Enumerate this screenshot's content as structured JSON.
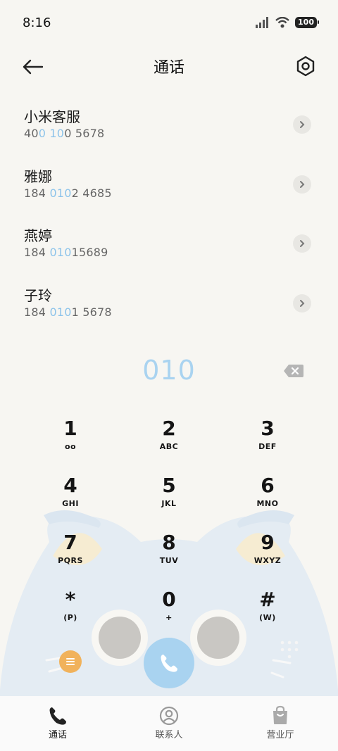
{
  "status": {
    "time": "8:16",
    "battery": "100"
  },
  "header": {
    "title": "通话",
    "back_icon": "arrow-left-icon",
    "settings_icon": "hexagon-settings-icon"
  },
  "results": [
    {
      "name": "小米客服",
      "number_parts": [
        "40",
        "0 10",
        "0 5678"
      ]
    },
    {
      "name": "雅娜",
      "number_parts": [
        "184 ",
        "010",
        "2 4685"
      ]
    },
    {
      "name": "燕婷",
      "number_parts": [
        "184 ",
        "010",
        "15689"
      ]
    },
    {
      "name": "子玲",
      "number_parts": [
        "184 ",
        "010",
        "1 5678"
      ]
    }
  ],
  "dialer": {
    "input": "010"
  },
  "keypad": [
    {
      "digit": "1",
      "letters": "oo"
    },
    {
      "digit": "2",
      "letters": "ABC"
    },
    {
      "digit": "3",
      "letters": "DEF"
    },
    {
      "digit": "4",
      "letters": "GHI"
    },
    {
      "digit": "5",
      "letters": "JKL"
    },
    {
      "digit": "6",
      "letters": "MNO"
    },
    {
      "digit": "7",
      "letters": "PQRS"
    },
    {
      "digit": "8",
      "letters": "TUV"
    },
    {
      "digit": "9",
      "letters": "WXYZ"
    },
    {
      "digit": "*",
      "letters": "(P)"
    },
    {
      "digit": "0",
      "letters": "+"
    },
    {
      "digit": "#",
      "letters": "(W)"
    }
  ],
  "tabs": [
    {
      "label": "通话",
      "icon": "phone-icon",
      "active": true
    },
    {
      "label": "联系人",
      "icon": "contact-icon",
      "active": false
    },
    {
      "label": "营业厅",
      "icon": "shopping-bag-icon",
      "active": false
    }
  ],
  "colors": {
    "accent": "#a9d3f0",
    "highlight": "#8cc3ea",
    "menu": "#f1b25b",
    "background": "#f7f6f2",
    "owl": "#e4ecf3"
  }
}
